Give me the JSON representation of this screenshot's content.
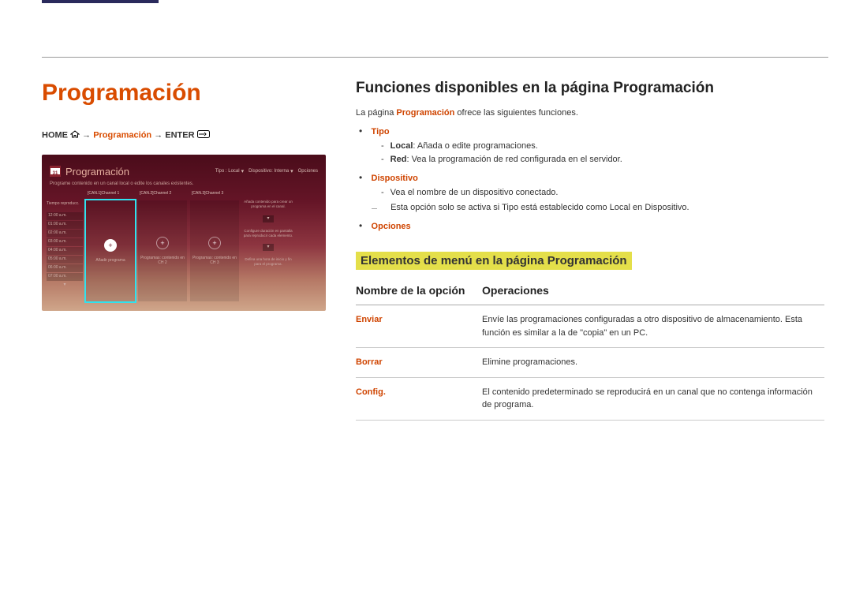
{
  "page": {
    "title": "Programación",
    "breadcrumb": {
      "home": "HOME",
      "path": "Programación",
      "enter": "ENTER",
      "arrow": "→"
    }
  },
  "screenshot": {
    "cal_number": "31",
    "title": "Programación",
    "top_right": {
      "tipo": "Tipo : Local",
      "disp": "Dispositivo: Interna",
      "opc": "Opciones"
    },
    "subtitle": "Programe contenido en un canal local o edite los canales existentes.",
    "time_header": "Tiempo reproducc.",
    "times": [
      "12:00 a.m.",
      "01:00 a.m.",
      "02:00 a.m.",
      "03:00 a.m.",
      "04:00 a.m.",
      "05:00 a.m.",
      "06:00 a.m.",
      "07:00 a.m."
    ],
    "channels": [
      {
        "label": "[CAN.1]Channel 1",
        "btn": "Añadir programa"
      },
      {
        "label": "[CAN.2]Channel 2",
        "btn": "Programas: contenido en CH 2"
      },
      {
        "label": "[CAN.3]Channel 3",
        "btn": "Programas: contenido en CH 3"
      }
    ],
    "tips": [
      "Añada contenido para crear un programa en el canal.",
      "Configure duración en pantalla para reproducir cada elemento.",
      "Defina una hora de inicio y fin para el programa."
    ]
  },
  "right": {
    "heading": "Funciones disponibles en la página Programación",
    "intro_pre": "La página ",
    "intro_bold": "Programación",
    "intro_post": " ofrece las siguientes funciones.",
    "items": {
      "tipo": {
        "label": "Tipo",
        "local_k": "Local",
        "local_v": ": Añada o edite programaciones.",
        "red_k": "Red",
        "red_v": ": Vea la programación de red configurada en el servidor."
      },
      "disp": {
        "label": "Dispositivo",
        "line1": "Vea el nombre de un dispositivo conectado.",
        "note_pre": "Esta opción solo se activa si ",
        "note_k1": "Tipo",
        "note_mid": " está establecido como ",
        "note_k2": "Local",
        "note_mid2": " en ",
        "note_k3": "Dispositivo",
        "note_end": "."
      },
      "opc": {
        "label": "Opciones"
      }
    },
    "sub_heading": "Elementos de menú en la página Programación",
    "table": {
      "h1": "Nombre de la opción",
      "h2": "Operaciones",
      "rows": [
        {
          "name": "Enviar",
          "desc": "Envíe las programaciones configuradas a otro dispositivo de almacenamiento. Esta función es similar a la de \"copia\" en un PC."
        },
        {
          "name": "Borrar",
          "desc": "Elimine programaciones."
        },
        {
          "name": "Config.",
          "desc": "El contenido predeterminado se reproducirá en un canal que no contenga información de programa."
        }
      ]
    }
  }
}
